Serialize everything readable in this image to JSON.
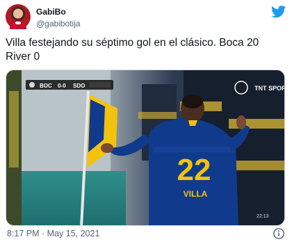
{
  "author": {
    "display_name": "GabiBo",
    "handle": "@gabibotija"
  },
  "tweet": {
    "text_line1": "Villa festejando su séptimo gol en el clásico. Boca 20",
    "text_line2": "River 0"
  },
  "media": {
    "scorebug": {
      "team_home": "BOC",
      "score": "0-0",
      "team_away": "SDO"
    },
    "broadcaster_logo": "TNT SPORTS",
    "jersey_number": "22",
    "jersey_name": "VILLA",
    "clip_time": "22:13"
  },
  "footer": {
    "timestamp": "8:17 PM · May 15, 2021"
  },
  "colors": {
    "twitter_blue": "#1d9bf0",
    "boca_blue": "#103b8c",
    "boca_yellow": "#f4c20d"
  },
  "icons": [
    "twitter-bird-icon",
    "info-icon"
  ]
}
